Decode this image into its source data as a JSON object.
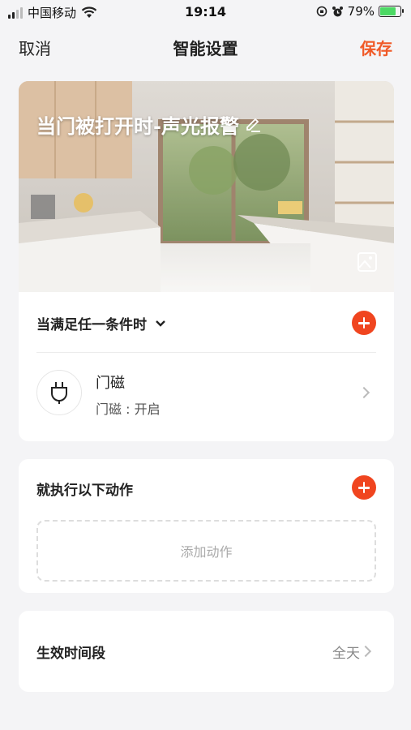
{
  "status_bar": {
    "carrier": "中国移动",
    "time": "19:14",
    "battery": "79%",
    "battery_level": 0.79
  },
  "nav": {
    "cancel": "取消",
    "title": "智能设置",
    "save": "保存"
  },
  "hero": {
    "title": "当门被打开时-声光报警",
    "icons": [
      "edit-icon",
      "image-icon"
    ]
  },
  "condition": {
    "title": "当满足任一条件时",
    "device": {
      "name": "门磁",
      "status": "门磁 : 开启",
      "icon": "plug-icon"
    }
  },
  "action": {
    "title": "就执行以下动作",
    "add_label": "添加动作"
  },
  "schedule": {
    "label": "生效时间段",
    "value": "全天"
  },
  "colors": {
    "accent": "#f05a28",
    "add_button": "#f0451f",
    "background": "#f4f4f6"
  }
}
